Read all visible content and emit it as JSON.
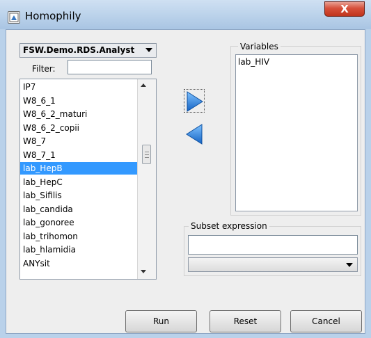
{
  "window": {
    "title": "Homophily",
    "close_label": "X"
  },
  "dataset": {
    "selected": "FSW.Demo.RDS.Analyst"
  },
  "filter": {
    "label": "Filter:",
    "value": ""
  },
  "variable_list": {
    "items": [
      "IP7",
      "W8_6_1",
      "W8_6_2_maturi",
      "W8_6_2_copii",
      "W8_7",
      "W8_7_1",
      "lab_HepB",
      "lab_HepC",
      "lab_Sifilis",
      "lab_candida",
      "lab_gonoree",
      "lab_trihomon",
      "lab_hlamidia",
      "ANYsit"
    ],
    "selected_index": 6
  },
  "variables_box": {
    "label": "Variables",
    "items": [
      "lab_HIV"
    ]
  },
  "subset": {
    "label": "Subset expression",
    "value": "",
    "combo_value": ""
  },
  "buttons": {
    "run": "Run",
    "reset": "Reset",
    "cancel": "Cancel"
  },
  "colors": {
    "selection": "#3399ff",
    "arrow_blue": "#1f7ad8",
    "titlebar": "#b9d1ea",
    "close": "#c7432b"
  }
}
